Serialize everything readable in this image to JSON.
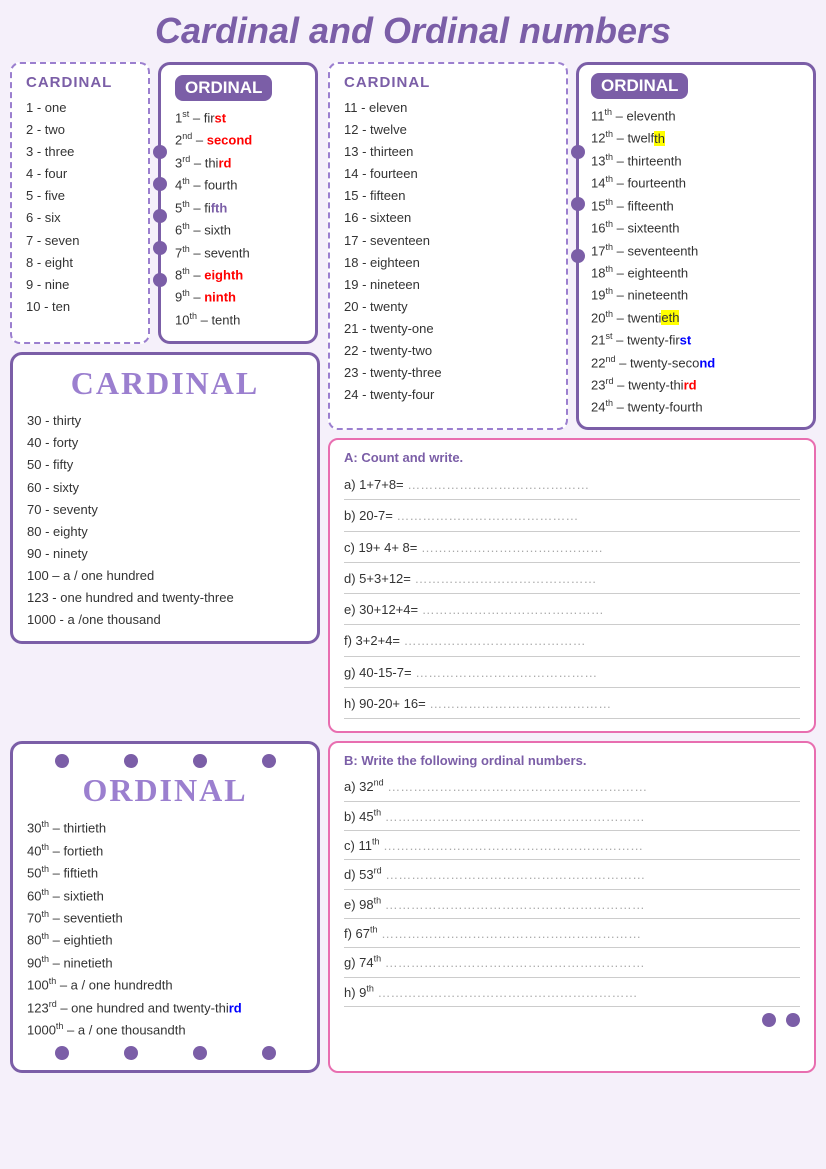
{
  "title": "Cardinal and Ordinal numbers",
  "top_left": {
    "cardinal_header": "CARDINAL",
    "cardinal_items": [
      "1 - one",
      "2 - two",
      "3 - three",
      "4 - four",
      "5 - five",
      "6 - six",
      "7 - seven",
      "8 - eight",
      "9 - nine",
      "10 - ten"
    ],
    "ordinal_header": "ORDINAL",
    "ordinal_items": [
      {
        "num": "1",
        "sup": "st",
        "dash": "– fir",
        "highlight": "st",
        "color": "red"
      },
      {
        "num": "2",
        "sup": "nd",
        "dash": "– se",
        "highlight": "cond",
        "color": "red"
      },
      {
        "num": "3",
        "sup": "rd",
        "dash": "– thi",
        "highlight": "rd",
        "color": "red"
      },
      {
        "num": "4",
        "sup": "th",
        "dash": "– fourth",
        "highlight": "",
        "color": ""
      },
      {
        "num": "5",
        "sup": "th",
        "dash": "– fi",
        "highlight": "fth",
        "color": "purple"
      },
      {
        "num": "6",
        "sup": "th",
        "dash": "– sixth",
        "highlight": "",
        "color": ""
      },
      {
        "num": "7",
        "sup": "th",
        "dash": "– seventh",
        "highlight": "",
        "color": ""
      },
      {
        "num": "8",
        "sup": "th",
        "dash": "– ",
        "highlight": "eighth",
        "color": "red"
      },
      {
        "num": "9",
        "sup": "th",
        "dash": "– ",
        "highlight": "ninth",
        "color": "red"
      },
      {
        "num": "10",
        "sup": "th",
        "dash": "– tenth",
        "highlight": "",
        "color": ""
      }
    ]
  },
  "top_right_cardinal": {
    "header": "CARDINAL",
    "items": [
      "11 - eleven",
      "12 - twelve",
      "13 - thirteen",
      "14 - fourteen",
      "15 - fifteen",
      "16 - sixteen",
      "17 - seventeen",
      "18 - eighteen",
      "19 - nineteen",
      "20 - twenty",
      "21 - twenty-one",
      "22 - twenty-two",
      "23 - twenty-three",
      "24 - twenty-four"
    ]
  },
  "top_right_ordinal": {
    "header": "ORDINAL",
    "items": [
      {
        "num": "11",
        "sup": "th",
        "text": "– eleventh"
      },
      {
        "num": "12",
        "sup": "th",
        "text": "– twelf",
        "hl": "th",
        "hl_color": "yellow"
      },
      {
        "num": "13",
        "sup": "th",
        "text": "– thirteenth"
      },
      {
        "num": "14",
        "sup": "th",
        "text": "– fourteenth"
      },
      {
        "num": "15",
        "sup": "th",
        "text": "– fifteenth"
      },
      {
        "num": "16",
        "sup": "th",
        "text": "– sixteenth"
      },
      {
        "num": "17",
        "sup": "th",
        "text": "– seventeenth"
      },
      {
        "num": "18",
        "sup": "th",
        "text": "– eighteenth"
      },
      {
        "num": "19",
        "sup": "th",
        "text": "– nineteenth"
      },
      {
        "num": "20",
        "sup": "th",
        "text": "– twentieth",
        "hl": "ieth",
        "hl_color": "yellow"
      },
      {
        "num": "21",
        "sup": "st",
        "text": "– twenty-fir",
        "hl": "st",
        "hl_color": "blue"
      },
      {
        "num": "22",
        "sup": "nd",
        "text": "– twenty-seco",
        "hl": "nd",
        "hl_color": "blue"
      },
      {
        "num": "23",
        "sup": "rd",
        "text": "– twenty-thi",
        "hl": "rd",
        "hl_color": "red"
      },
      {
        "num": "24",
        "sup": "th",
        "text": "– twenty-fourth"
      }
    ]
  },
  "mid_left_cardinal": {
    "header": "CARDINAL",
    "items": [
      "30 - thirty",
      "40 - forty",
      "50 - fifty",
      "60 - sixty",
      "70 - seventy",
      "80 - eighty",
      "90 - ninety",
      "100 – a / one hundred",
      "123 - one hundred and twenty-three",
      "1000 - a /one thousand"
    ]
  },
  "bottom_left_ordinal": {
    "header": "ORDINAL",
    "items": [
      {
        "num": "30",
        "sup": "th",
        "text": "– thirtieth"
      },
      {
        "num": "40",
        "sup": "th",
        "text": "– fortieth"
      },
      {
        "num": "50",
        "sup": "th",
        "text": "– fiftieth"
      },
      {
        "num": "60",
        "sup": "th",
        "text": "– sixtieth"
      },
      {
        "num": "70",
        "sup": "th",
        "text": "– seventieth"
      },
      {
        "num": "80",
        "sup": "th",
        "text": "– eightieth"
      },
      {
        "num": "90",
        "sup": "th",
        "text": "– ninetieth"
      },
      {
        "num": "100",
        "sup": "th",
        "text": "– a / one hundredth"
      },
      {
        "num": "123",
        "sup": "rd",
        "text": "– one hundred and twenty-thi",
        "hl": "rd",
        "hl_color": "blue"
      },
      {
        "num": "1000",
        "sup": "th",
        "text": "– a / one thousandth"
      }
    ]
  },
  "exercise_a": {
    "title": "A: Count and write.",
    "items": [
      "a) 1+7+8= ……………………………………",
      "b) 20-7= ……………………………………",
      "c) 19+ 4+ 8= ……………………………………",
      "d) 5+3+12= ……………………………………",
      "e) 30+12+4= ……………………………………",
      "f) 3+2+4= ……………………………………",
      "g) 40-15-7= ……………………………………",
      "h) 90-20+ 16= ……………………………………"
    ]
  },
  "exercise_b": {
    "title": "B: Write the following ordinal numbers.",
    "items": [
      {
        "label": "a) 32",
        "sup": "nd"
      },
      {
        "label": "b) 45",
        "sup": "th"
      },
      {
        "label": "c) 11",
        "sup": "th"
      },
      {
        "label": "d) 53",
        "sup": "rd"
      },
      {
        "label": "e) 98",
        "sup": "th"
      },
      {
        "label": "f) 67",
        "sup": "th"
      },
      {
        "label": "g) 74",
        "sup": "th"
      },
      {
        "label": "h) 9",
        "sup": "th"
      }
    ]
  },
  "dots": [
    "•",
    "•",
    "•",
    "•",
    "•"
  ]
}
